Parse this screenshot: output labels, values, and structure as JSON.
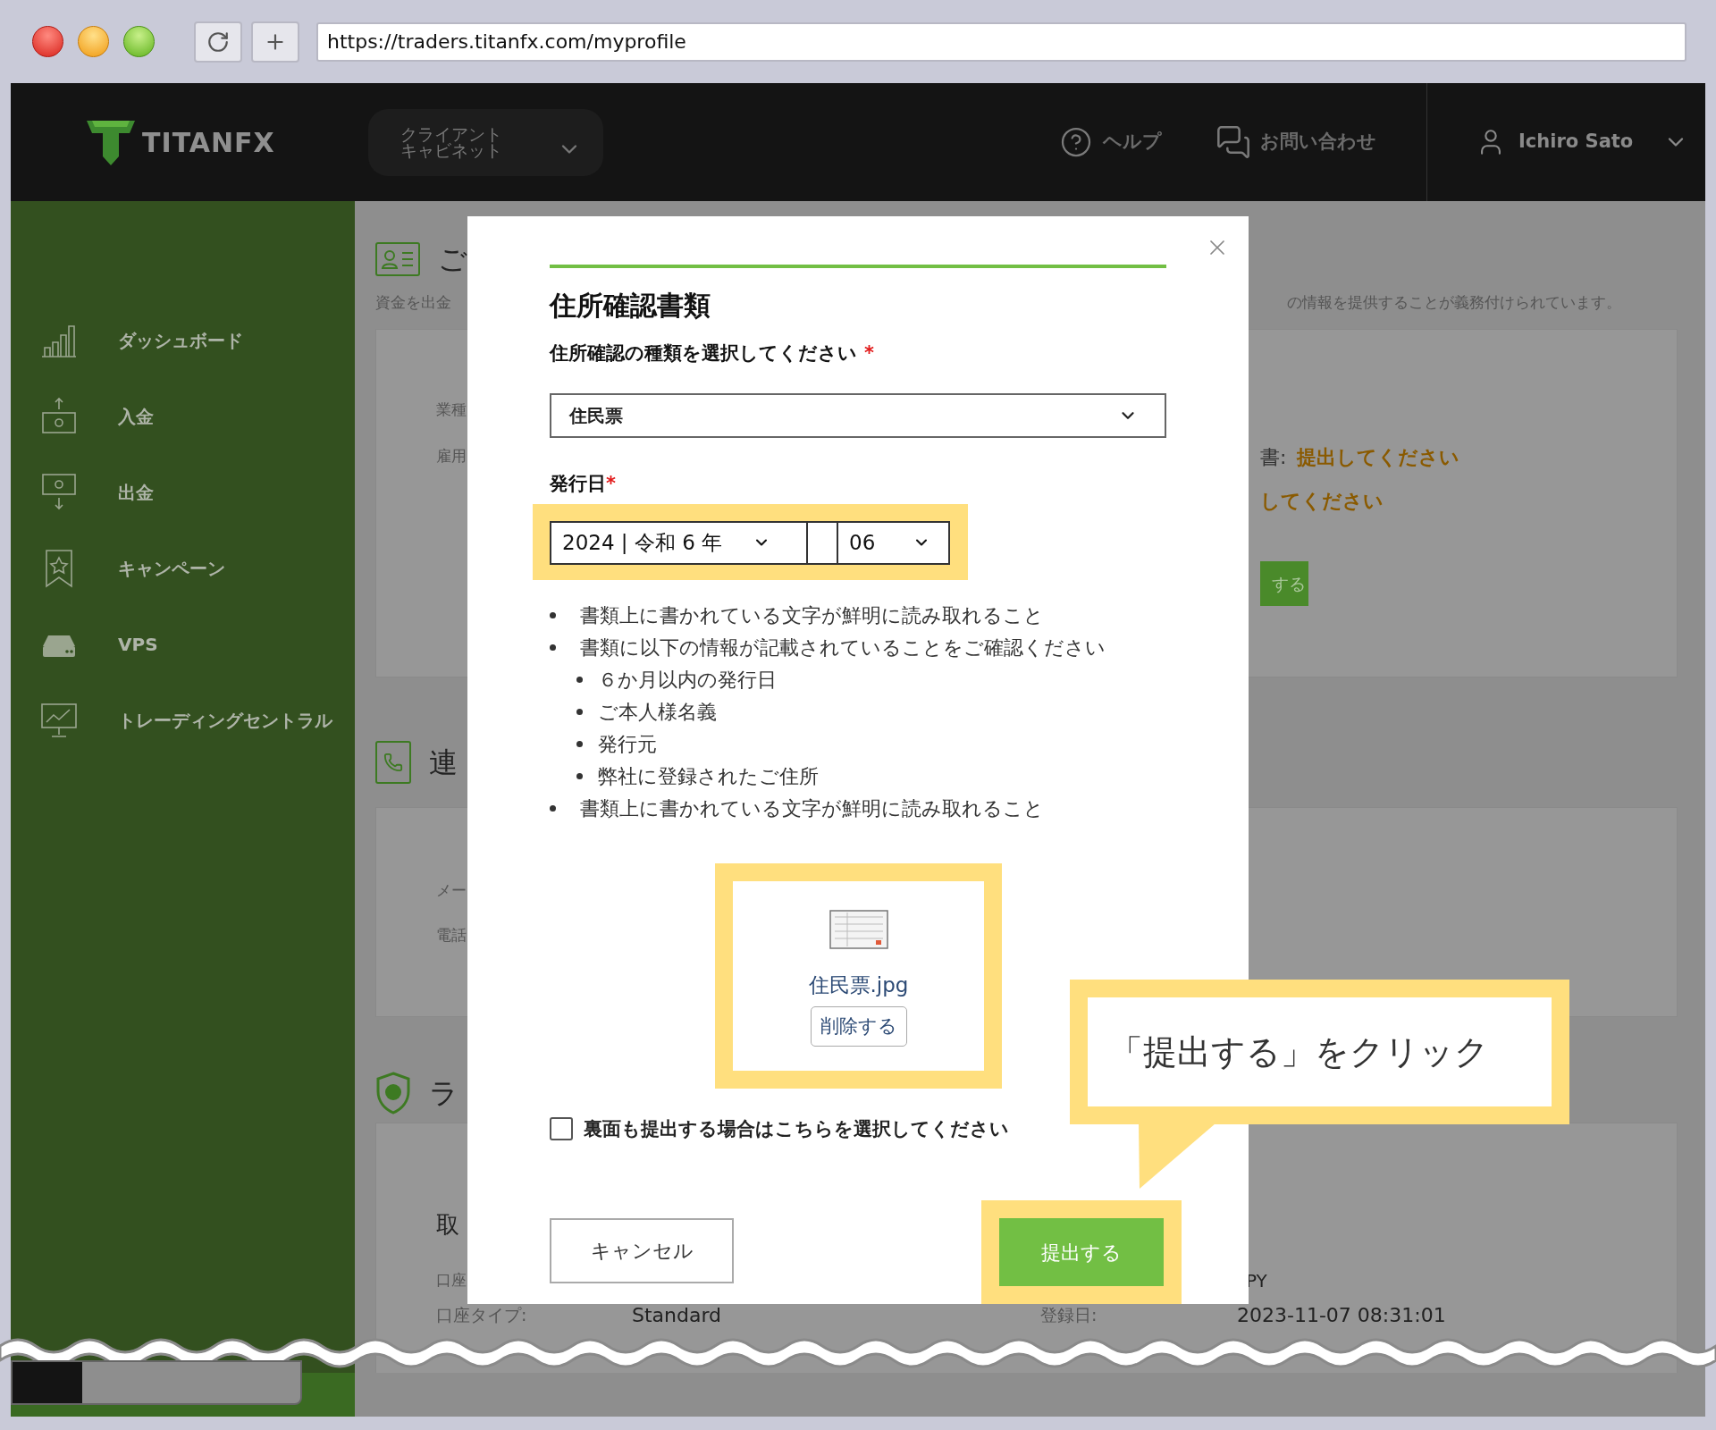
{
  "browser": {
    "url": "https://traders.titanfx.com/myprofile"
  },
  "header": {
    "logo": "TITANFX",
    "cabinet_label": [
      "クライアント",
      "キャビネット"
    ],
    "help": "ヘルプ",
    "contact": "お問い合わせ",
    "user": "Ichiro Sato"
  },
  "sidebar": {
    "items": [
      {
        "label": "ダッシュボード"
      },
      {
        "label": "入金"
      },
      {
        "label": "出金"
      },
      {
        "label": "キャンペーン"
      },
      {
        "label": "VPS"
      },
      {
        "label": "トレーディングセントラル"
      }
    ]
  },
  "page": {
    "section_1": {
      "heading": "ご",
      "note": "資金を出金",
      "note_right": "の情報を提供することが義務付けられています。",
      "labels": [
        "業種",
        "雇用"
      ],
      "status_label": "書:",
      "status_values": [
        "提出してください",
        "してください"
      ],
      "button": "する"
    },
    "section_2": {
      "heading": "連",
      "labels": [
        "メー",
        "電話"
      ]
    },
    "section_3": {
      "heading": "ラ",
      "subheading": "取",
      "label": "口座",
      "value_right": "PY",
      "rows": [
        {
          "label": "口座タイプ:",
          "value": "Standard",
          "label_2": "登録日:",
          "value_2": "2023-11-07 08:31:01"
        }
      ]
    }
  },
  "modal": {
    "title": "住所確認書類",
    "type_label": "住所確認の種類を選択してください",
    "required_mark": "*",
    "type_value": "住民票",
    "date_label": "発行日",
    "date_required_mark": "*",
    "year": "2024 | 令和 6 年",
    "month": "06",
    "requirements": [
      {
        "text": "書類上に書かれている文字が鮮明に読み取れること"
      },
      {
        "text": "書類に以下の情報が記載されていることをご確認ください",
        "children": [
          {
            "text": "６か月以内の発行日"
          },
          {
            "text": "ご本人様名義"
          },
          {
            "text": "発行元"
          },
          {
            "text": "弊社に登録されたご住所"
          }
        ]
      },
      {
        "text": "書類上に書かれている文字が鮮明に読み取れること"
      }
    ],
    "file_name": "住民票.jpg",
    "delete_button": "削除する",
    "back_side": {
      "label": "裏面も提出する場合はこちらを選択してください",
      "checked": false
    },
    "cancel_button": "キャンセル",
    "submit_button": "提出する"
  },
  "callout": {
    "text": "「提出する」をクリック"
  }
}
